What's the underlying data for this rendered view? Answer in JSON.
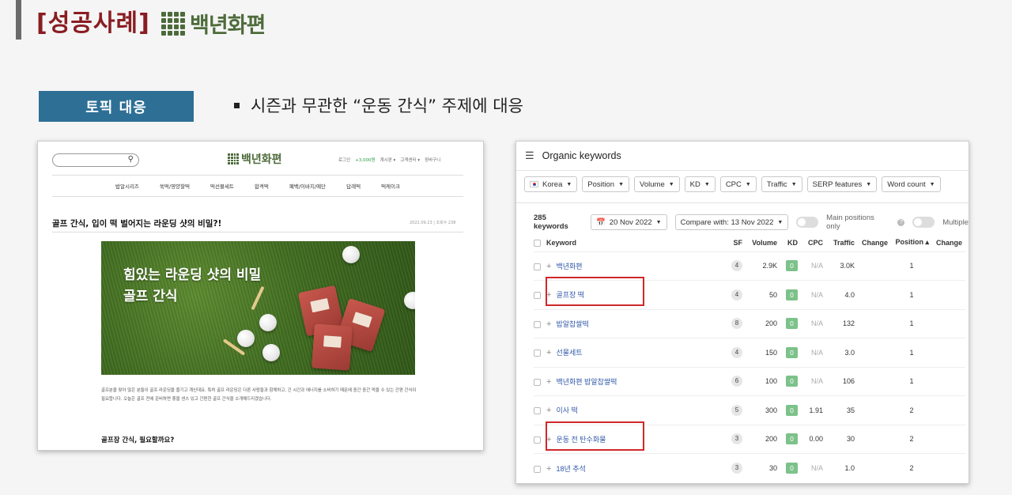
{
  "header": {
    "title": "[성공사례]",
    "brand": "백년화편"
  },
  "topic": {
    "badge": "토픽 대응",
    "bullet": "시즌과 무관한 “운동 간식” 주제에 대응"
  },
  "site": {
    "logo": "백년화편",
    "util_links": [
      "로그인",
      "+3,000원",
      "계시판 ▾",
      "고객센터 ▾",
      "장바구니"
    ],
    "nav": [
      "밥알시리즈",
      "쑥떡/영양찰떡",
      "떡선물세트",
      "합격떡",
      "폐백/이바지/예단",
      "답례떡",
      "떡케이크"
    ],
    "article_title": "골프 간식, 입이 떡 벌어지는 라운딩 샷의 비밀?!",
    "article_date": "2022.09.23 | 조회수 238",
    "hero_line1": "힘있는 라운딩 샷의 비밀",
    "hero_line2": "골프 간식",
    "body_text": "골프분을 맞아 많은 분들이 골프 라운딩을 즐기고 계신데요. 특히 골프 라운딩은 다른 사람들과 함께하고, 긴 시간과 에너지를 소비하기 때문에 중간 중간 먹을 수 있는 간편 간식이 필요합니다. 오늘은 골프 전에 준비하면 좋을 센스 있고 간편한 골프 간식을 소개해드리겠습니다.",
    "subheading": "골프장 간식, 필요할까요?"
  },
  "ahrefs": {
    "panel_title": "Organic keywords",
    "filters": [
      "Korea",
      "Position",
      "Volume",
      "KD",
      "CPC",
      "Traffic",
      "SERP features",
      "Word count"
    ],
    "keyword_count": "285 keywords",
    "date": "20 Nov 2022",
    "compare": "Compare with: 13 Nov 2022",
    "main_positions_label": "Main positions only",
    "multiple_label": "Multiple",
    "columns": [
      "Keyword",
      "SF",
      "Volume",
      "KD",
      "CPC",
      "Traffic",
      "Change",
      "Position ▴",
      "Change"
    ],
    "rows": [
      {
        "keyword": "백년화편",
        "sf": "4",
        "volume": "2.9K",
        "kd": "0",
        "cpc": "N/A",
        "traffic": "3.0K",
        "change": "",
        "position": "1",
        "pos_change": ""
      },
      {
        "keyword": "골프장 떡",
        "sf": "4",
        "volume": "50",
        "kd": "0",
        "cpc": "N/A",
        "traffic": "4.0",
        "change": "",
        "position": "1",
        "pos_change": ""
      },
      {
        "keyword": "밥알찹쌀떡",
        "sf": "8",
        "volume": "200",
        "kd": "0",
        "cpc": "N/A",
        "traffic": "132",
        "change": "",
        "position": "1",
        "pos_change": ""
      },
      {
        "keyword": "선물세트",
        "sf": "4",
        "volume": "150",
        "kd": "0",
        "cpc": "N/A",
        "traffic": "3.0",
        "change": "",
        "position": "1",
        "pos_change": ""
      },
      {
        "keyword": "백년화편 밥알찹쌀떡",
        "sf": "6",
        "volume": "100",
        "kd": "0",
        "cpc": "N/A",
        "traffic": "106",
        "change": "",
        "position": "1",
        "pos_change": ""
      },
      {
        "keyword": "이사 떡",
        "sf": "5",
        "volume": "300",
        "kd": "0",
        "cpc": "1.91",
        "traffic": "35",
        "change": "",
        "position": "2",
        "pos_change": ""
      },
      {
        "keyword": "운동 전 탄수화물",
        "sf": "3",
        "volume": "200",
        "kd": "0",
        "cpc": "0.00",
        "traffic": "30",
        "change": "",
        "position": "2",
        "pos_change": ""
      },
      {
        "keyword": "18년 추석",
        "sf": "3",
        "volume": "30",
        "kd": "0",
        "cpc": "N/A",
        "traffic": "1.0",
        "change": "",
        "position": "2",
        "pos_change": ""
      }
    ],
    "highlight_color": "#d0282a"
  }
}
